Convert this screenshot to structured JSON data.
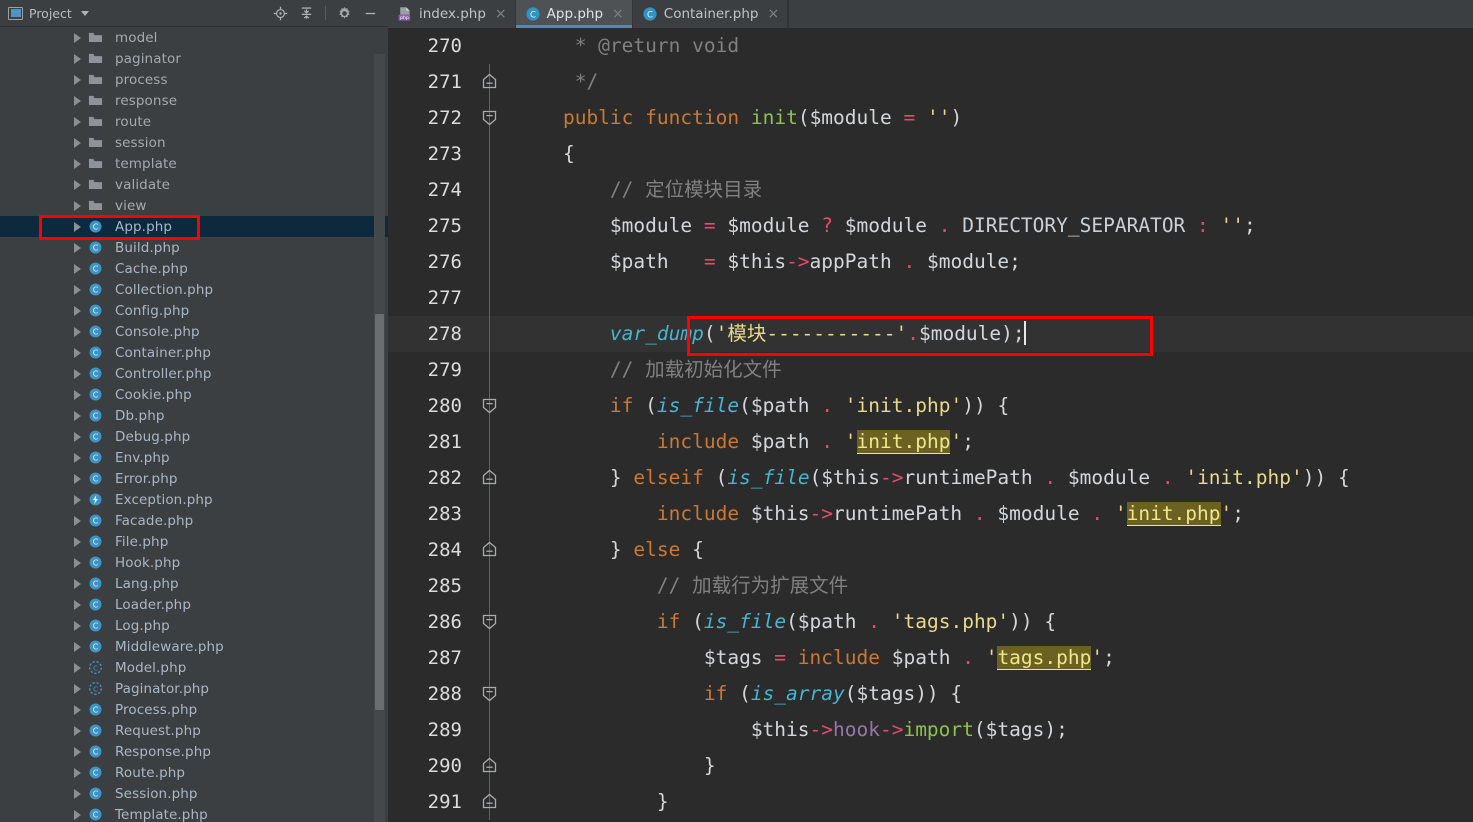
{
  "project_panel": {
    "header": {
      "title": "Project",
      "icon": "project-window-icon",
      "caret": "chevron-down-icon",
      "tools": [
        "locate-icon",
        "collapse-all-icon",
        "settings-gear-icon",
        "minimize-icon"
      ]
    },
    "tree": [
      {
        "label": "model",
        "kind": "folder",
        "indent": 0,
        "selected": false
      },
      {
        "label": "paginator",
        "kind": "folder",
        "indent": 0,
        "selected": false
      },
      {
        "label": "process",
        "kind": "folder",
        "indent": 0,
        "selected": false
      },
      {
        "label": "response",
        "kind": "folder",
        "indent": 0,
        "selected": false
      },
      {
        "label": "route",
        "kind": "folder",
        "indent": 0,
        "selected": false
      },
      {
        "label": "session",
        "kind": "folder",
        "indent": 0,
        "selected": false
      },
      {
        "label": "template",
        "kind": "folder",
        "indent": 0,
        "selected": false
      },
      {
        "label": "validate",
        "kind": "folder",
        "indent": 0,
        "selected": false
      },
      {
        "label": "view",
        "kind": "folder",
        "indent": 0,
        "selected": false
      },
      {
        "label": "App.php",
        "kind": "class",
        "indent": 0,
        "selected": true
      },
      {
        "label": "Build.php",
        "kind": "class",
        "indent": 0,
        "selected": false
      },
      {
        "label": "Cache.php",
        "kind": "class",
        "indent": 0,
        "selected": false
      },
      {
        "label": "Collection.php",
        "kind": "class",
        "indent": 0,
        "selected": false
      },
      {
        "label": "Config.php",
        "kind": "class",
        "indent": 0,
        "selected": false
      },
      {
        "label": "Console.php",
        "kind": "class",
        "indent": 0,
        "selected": false
      },
      {
        "label": "Container.php",
        "kind": "class",
        "indent": 0,
        "selected": false
      },
      {
        "label": "Controller.php",
        "kind": "class",
        "indent": 0,
        "selected": false
      },
      {
        "label": "Cookie.php",
        "kind": "class",
        "indent": 0,
        "selected": false
      },
      {
        "label": "Db.php",
        "kind": "class",
        "indent": 0,
        "selected": false
      },
      {
        "label": "Debug.php",
        "kind": "class",
        "indent": 0,
        "selected": false
      },
      {
        "label": "Env.php",
        "kind": "class",
        "indent": 0,
        "selected": false
      },
      {
        "label": "Error.php",
        "kind": "class",
        "indent": 0,
        "selected": false
      },
      {
        "label": "Exception.php",
        "kind": "exception",
        "indent": 0,
        "selected": false
      },
      {
        "label": "Facade.php",
        "kind": "class",
        "indent": 0,
        "selected": false
      },
      {
        "label": "File.php",
        "kind": "class",
        "indent": 0,
        "selected": false
      },
      {
        "label": "Hook.php",
        "kind": "class",
        "indent": 0,
        "selected": false
      },
      {
        "label": "Lang.php",
        "kind": "class",
        "indent": 0,
        "selected": false
      },
      {
        "label": "Loader.php",
        "kind": "class",
        "indent": 0,
        "selected": false
      },
      {
        "label": "Log.php",
        "kind": "class",
        "indent": 0,
        "selected": false
      },
      {
        "label": "Middleware.php",
        "kind": "class",
        "indent": 0,
        "selected": false
      },
      {
        "label": "Model.php",
        "kind": "abstract",
        "indent": 0,
        "selected": false
      },
      {
        "label": "Paginator.php",
        "kind": "abstract",
        "indent": 0,
        "selected": false
      },
      {
        "label": "Process.php",
        "kind": "class",
        "indent": 0,
        "selected": false
      },
      {
        "label": "Request.php",
        "kind": "class",
        "indent": 0,
        "selected": false
      },
      {
        "label": "Response.php",
        "kind": "class",
        "indent": 0,
        "selected": false
      },
      {
        "label": "Route.php",
        "kind": "class",
        "indent": 0,
        "selected": false
      },
      {
        "label": "Session.php",
        "kind": "class",
        "indent": 0,
        "selected": false
      },
      {
        "label": "Template.php",
        "kind": "class",
        "indent": 0,
        "selected": false
      }
    ]
  },
  "editor": {
    "tabs": [
      {
        "label": "index.php",
        "icon": "php-file-icon",
        "active": false,
        "close": "×"
      },
      {
        "label": "App.php",
        "icon": "php-class-icon",
        "active": true,
        "close": "×"
      },
      {
        "label": "Container.php",
        "icon": "php-class-icon",
        "active": false,
        "close": "×"
      }
    ],
    "first_line_number": 270,
    "current_line_number": 278,
    "lines": [
      {
        "n": "270",
        "fold": "bar",
        "current": false
      },
      {
        "n": "271",
        "fold": "end",
        "current": false
      },
      {
        "n": "272",
        "fold": "start",
        "current": false
      },
      {
        "n": "273",
        "fold": "bar",
        "current": false
      },
      {
        "n": "274",
        "fold": "bar",
        "current": false
      },
      {
        "n": "275",
        "fold": "bar",
        "current": false
      },
      {
        "n": "276",
        "fold": "bar",
        "current": false
      },
      {
        "n": "277",
        "fold": "bar",
        "current": false
      },
      {
        "n": "278",
        "fold": "bar",
        "current": true
      },
      {
        "n": "279",
        "fold": "bar",
        "current": false
      },
      {
        "n": "280",
        "fold": "start",
        "current": false
      },
      {
        "n": "281",
        "fold": "bar",
        "current": false
      },
      {
        "n": "282",
        "fold": "end",
        "current": false
      },
      {
        "n": "283",
        "fold": "bar",
        "current": false
      },
      {
        "n": "284",
        "fold": "end",
        "current": false
      },
      {
        "n": "285",
        "fold": "bar",
        "current": false
      },
      {
        "n": "286",
        "fold": "start",
        "current": false
      },
      {
        "n": "287",
        "fold": "bar",
        "current": false
      },
      {
        "n": "288",
        "fold": "start",
        "current": false
      },
      {
        "n": "289",
        "fold": "bar",
        "current": false
      },
      {
        "n": "290",
        "fold": "end",
        "current": false
      },
      {
        "n": "291",
        "fold": "end",
        "current": false
      }
    ],
    "source_text": [
      "     * @return void",
      "     */",
      "    public function init($module = '')",
      "    {",
      "        // 定位模块目录",
      "        $module = $module ? $module . DIRECTORY_SEPARATOR : '';",
      "        $path   = $this->appPath . $module;",
      "",
      "        var_dump('模块-----------'.$module);",
      "        // 加载初始化文件",
      "        if (is_file($path . 'init.php')) {",
      "            include $path . 'init.php';",
      "        } elseif (is_file($this->runtimePath . $module . 'init.php')) {",
      "            include $this->runtimePath . $module . 'init.php';",
      "        } else {",
      "            // 加载行为扩展文件",
      "            if (is_file($path . 'tags.php')) {",
      "                $tags = include $path . 'tags.php';",
      "                if (is_array($tags)) {",
      "                    $this->hook->import($tags);",
      "                }",
      "            }"
    ]
  },
  "annotations": [
    {
      "name": "app-php-highlight-box",
      "color": "#fe0000",
      "target": "App.php tree item"
    },
    {
      "name": "var-dump-highlight-box",
      "color": "#fe0000",
      "target": "line 278 var_dump statement"
    }
  ],
  "theme": {
    "editor_bg": "#2b2b2b",
    "current_line_bg": "#323232",
    "panel_bg": "#3c3f41",
    "selection_bg": "#0d293e",
    "tab_active_bg": "#4e5254",
    "tab_underline": "#4a88c7",
    "keyword": "#cc7832",
    "string": "#e8d98b",
    "comment": "#808080",
    "function": "#46b5d1",
    "operator": "#e8496f",
    "field": "#9876aa",
    "search_highlight_bg": "#6b6121"
  }
}
